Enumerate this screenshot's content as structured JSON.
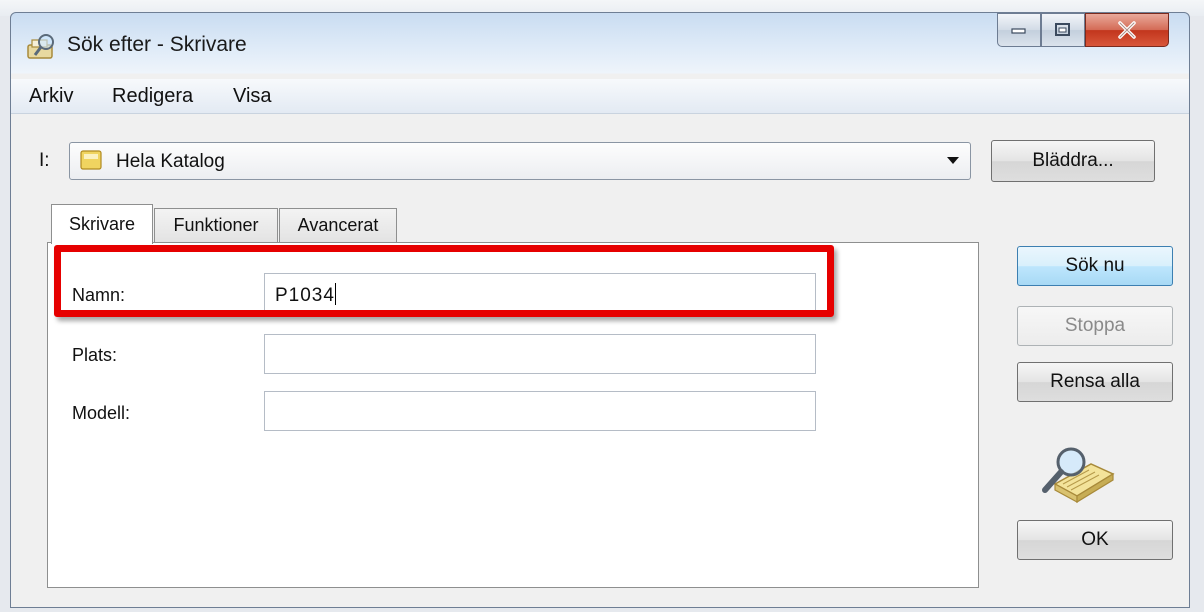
{
  "window": {
    "title": "Sök efter - Skrivare"
  },
  "menu": {
    "items": [
      "Arkiv",
      "Redigera",
      "Visa"
    ]
  },
  "location": {
    "label": "I:",
    "value": "Hela Katalog",
    "browse_label": "Bläddra..."
  },
  "tabs": [
    {
      "label": "Skrivare",
      "active": true
    },
    {
      "label": "Funktioner",
      "active": false
    },
    {
      "label": "Avancerat",
      "active": false
    }
  ],
  "fields": {
    "name": {
      "label": "Namn:",
      "value": "P1034"
    },
    "location": {
      "label": "Plats:",
      "value": ""
    },
    "model": {
      "label": "Modell:",
      "value": ""
    }
  },
  "actions": {
    "search_now": "Sök nu",
    "stop": "Stoppa",
    "clear_all": "Rensa alla",
    "ok": "OK"
  },
  "icons": {
    "title": "search-printer-icon",
    "folder": "directory-icon",
    "dropdown": "chevron-down-icon",
    "art": "search-magnifier-art"
  },
  "colors": {
    "highlight": "#e60000",
    "close_button": "#c2361d",
    "primary_button": "#a7d9f5"
  }
}
